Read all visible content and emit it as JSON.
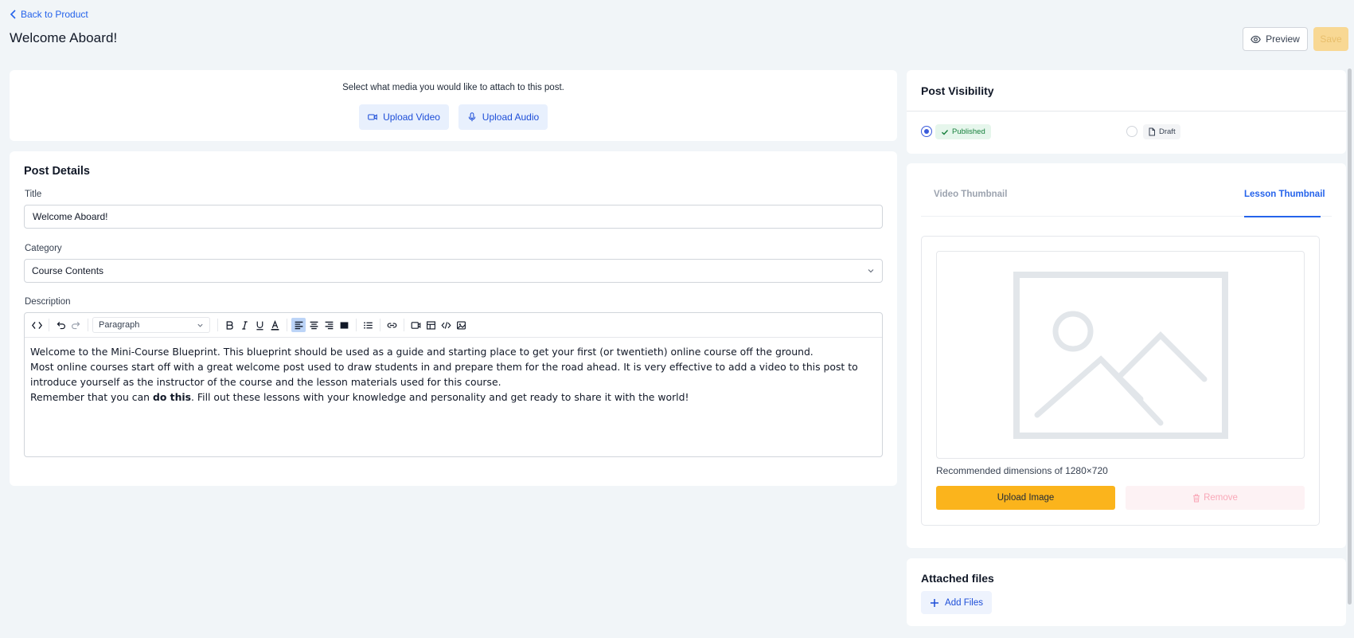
{
  "header": {
    "back_label": "Back to Product",
    "page_title": "Welcome Aboard!",
    "preview_label": "Preview",
    "save_label": "Save"
  },
  "media": {
    "prompt": "Select what media you would like to attach to this post.",
    "upload_video_label": "Upload Video",
    "upload_audio_label": "Upload Audio"
  },
  "post_details": {
    "heading": "Post Details",
    "title_label": "Title",
    "title_value": "Welcome Aboard!",
    "category_label": "Category",
    "category_value": "Course Contents",
    "description_label": "Description",
    "toolbar": {
      "paragraph_style": "Paragraph",
      "active_alignment": "align-left"
    },
    "description": {
      "line1": "Welcome to the Mini-Course Blueprint. This blueprint should be used as a guide and starting place to get your first (or twentieth) online course off the ground.",
      "line2": "Most online courses start off with a great welcome post used to draw students in and prepare them for the road ahead. It is very effective to add a video to this post to introduce yourself as the instructor of the course and the lesson materials used for this course.",
      "line3_before": "Remember that you can ",
      "line3_bold": "do this",
      "line3_after": ". Fill out these lessons with your knowledge and personality and get ready to share it with the world!"
    }
  },
  "visibility": {
    "heading": "Post Visibility",
    "selected": "published",
    "published_label": "Published",
    "draft_label": "Draft"
  },
  "thumbnail": {
    "tabs": [
      "Video Thumbnail",
      "Lesson Thumbnail"
    ],
    "active_tab": "Lesson Thumbnail",
    "recommended_text": "Recommended dimensions of 1280×720",
    "upload_label": "Upload Image",
    "remove_label": "Remove"
  },
  "attached_files": {
    "heading": "Attached files",
    "add_label": "Add Files"
  },
  "colors": {
    "accent_blue": "#2563eb",
    "save_disabled": "#f8d894",
    "upload_yellow": "#fbb41c",
    "published_green": "#16803c"
  }
}
